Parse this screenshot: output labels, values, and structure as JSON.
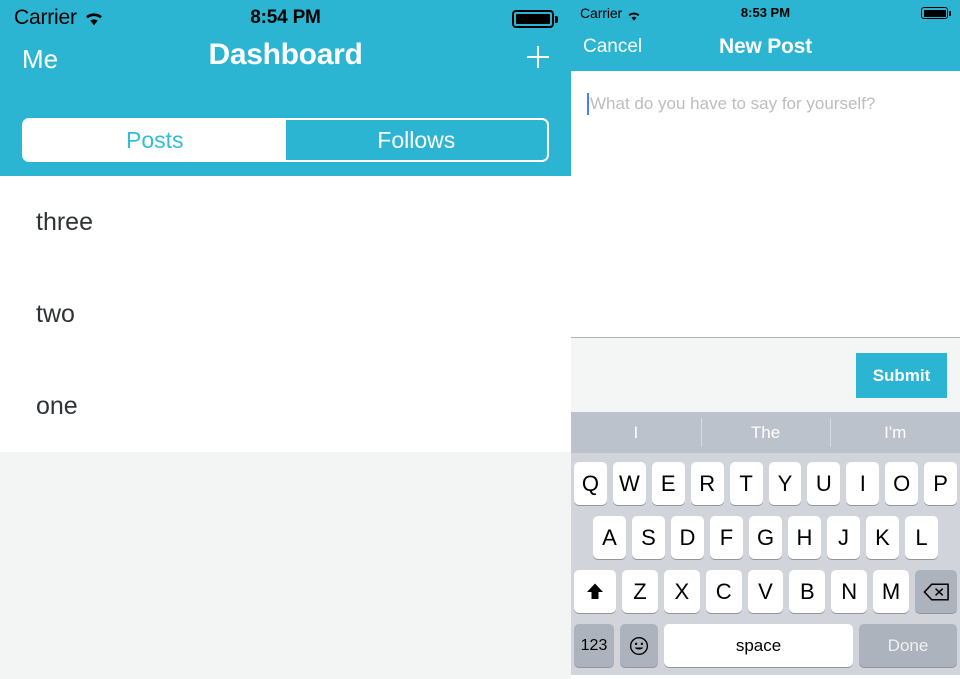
{
  "left_panel": {
    "status_bar": {
      "carrier": "Carrier",
      "wifi_icon": "wifi-icon",
      "time": "8:54 PM",
      "battery_icon": "battery-full-icon"
    },
    "nav": {
      "back_label": "Me",
      "title": "Dashboard",
      "add_icon": "plus-icon"
    },
    "segmented_control": {
      "options": [
        {
          "label": "Posts",
          "selected": true
        },
        {
          "label": "Follows",
          "selected": false
        }
      ]
    },
    "list": {
      "rows": [
        "three",
        "two",
        "one"
      ]
    }
  },
  "right_panel": {
    "status_bar": {
      "carrier": "Carrier",
      "wifi_icon": "wifi-icon",
      "time": "8:53 PM",
      "battery_icon": "battery-full-icon"
    },
    "nav": {
      "cancel_label": "Cancel",
      "title": "New Post"
    },
    "compose": {
      "value": "",
      "placeholder": "What do you have to say for yourself?"
    },
    "accessory": {
      "submit_label": "Submit"
    },
    "predictive_bar": {
      "suggestions": [
        "I",
        "The",
        "I'm"
      ]
    },
    "keyboard": {
      "row1": [
        "Q",
        "W",
        "E",
        "R",
        "T",
        "Y",
        "U",
        "I",
        "O",
        "P"
      ],
      "row2": [
        "A",
        "S",
        "D",
        "F",
        "G",
        "H",
        "J",
        "K",
        "L"
      ],
      "row3": [
        "Z",
        "X",
        "C",
        "V",
        "B",
        "N",
        "M"
      ],
      "shift_icon": "shift-icon",
      "backspace_icon": "backspace-icon",
      "numbers_label": "123",
      "emoji_icon": "emoji-smiley-icon",
      "space_label": "space",
      "done_label": "Done"
    }
  },
  "colors": {
    "accent": "#2bb5d3",
    "segment_selected_text": "#35bcd8",
    "keyboard_bg": "#d1d4db",
    "predictive_bg": "#bcc2cb",
    "accessory_bg": "#f4f5f5",
    "list_footer_bg": "#f3f5f5",
    "caret": "#4a7cf7",
    "placeholder_text": "#bdbdbd",
    "list_text": "#2f3337"
  }
}
